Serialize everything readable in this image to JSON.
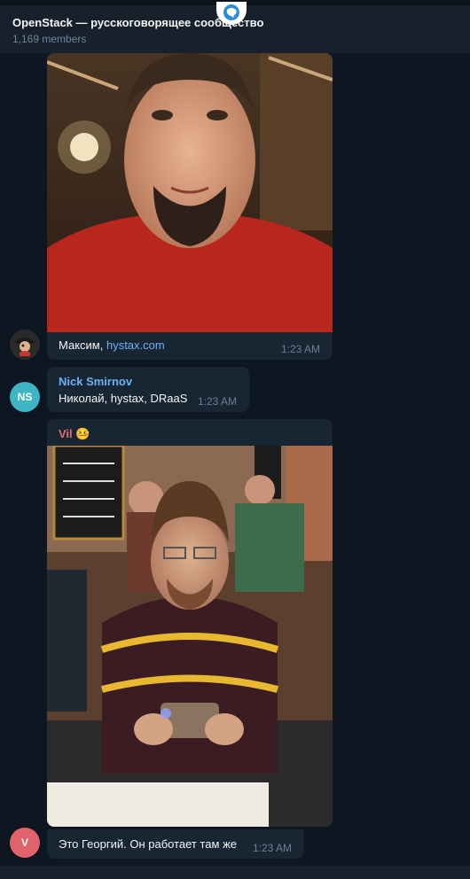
{
  "header": {
    "title": "OpenStack — русскоговорящее сообщество",
    "members": "1,169 members"
  },
  "messages": [
    {
      "caption_prefix": "Максим, ",
      "caption_link": "hystax.com",
      "time": "1:23 AM",
      "avatar_icon": "pirate-avatar-icon"
    },
    {
      "sender": "Nick Smirnov",
      "sender_color": "#6ab3f3",
      "avatar_initials": "NS",
      "avatar_color": "#3fb5c4",
      "text": "Николай, hystax, DRaaS",
      "time": "1:23 AM"
    },
    {
      "sender": "Vil 🤒",
      "sender_color": "#e36f6f",
      "avatar_initials": "V",
      "avatar_color": "#e0636b",
      "text": "Это Георгий. Он работает там же",
      "time": "1:23 AM"
    }
  ],
  "colors": {
    "background": "#0e1621",
    "bubble": "#182533",
    "header": "#17212b",
    "link": "#6ab3f3"
  }
}
